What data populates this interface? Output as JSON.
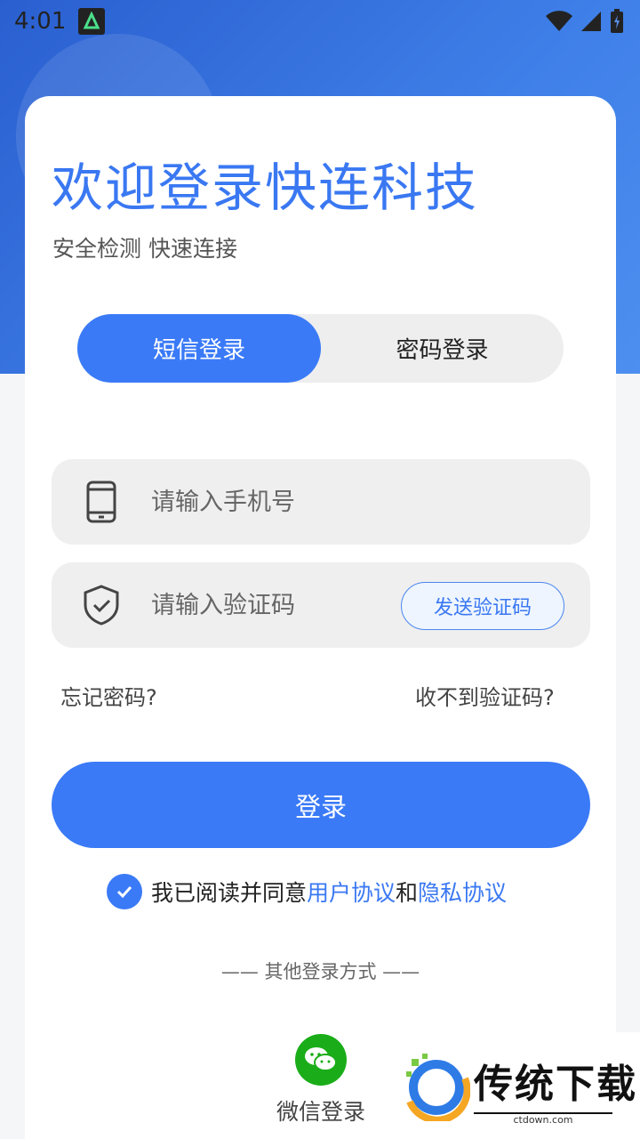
{
  "status_bar": {
    "time": "4:01"
  },
  "header": {
    "title": "欢迎登录快连科技",
    "subtitle": "安全检测 快速连接"
  },
  "tabs": [
    {
      "label": "短信登录",
      "active": true
    },
    {
      "label": "密码登录",
      "active": false
    }
  ],
  "phone_field": {
    "placeholder": "请输入手机号",
    "icon": "phone-icon"
  },
  "code_field": {
    "placeholder": "请输入验证码",
    "icon": "shield-check-icon",
    "send_label": "发送验证码"
  },
  "links": {
    "forgot_password": "忘记密码?",
    "no_code": "收不到验证码?"
  },
  "login_button": {
    "label": "登录"
  },
  "agreement": {
    "prefix": "我已阅读并同意",
    "user_agreement": "用户协议",
    "and": "和",
    "privacy_policy": "隐私协议",
    "checked": true
  },
  "other_login": {
    "label": "—— 其他登录方式 ——"
  },
  "wechat_login": {
    "label": "微信登录"
  },
  "watermark": {
    "name": "传统下载",
    "url": "ctdown.com"
  },
  "colors": {
    "accent": "#3a7af7",
    "wechat": "#1aad19"
  }
}
